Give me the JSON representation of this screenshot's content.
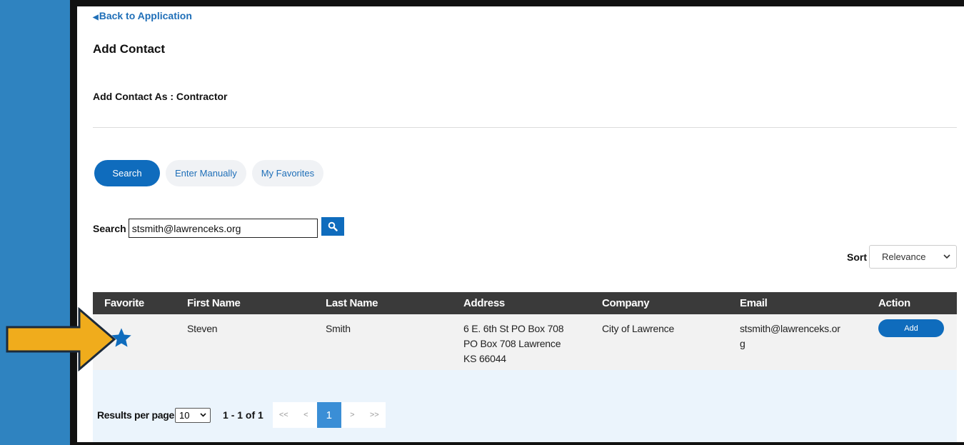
{
  "nav": {
    "back_label": "Back to Application"
  },
  "page": {
    "title": "Add Contact",
    "add_as": "Add Contact As  : Contractor"
  },
  "tabs": [
    {
      "label": "Search",
      "active": true
    },
    {
      "label": "Enter Manually",
      "active": false
    },
    {
      "label": "My Favorites",
      "active": false
    }
  ],
  "search": {
    "label": "Search",
    "value": "stsmith@lawrenceks.org",
    "button_icon": "search-icon"
  },
  "sort": {
    "label": "Sort",
    "selected": "Relevance"
  },
  "table": {
    "headers": [
      "Favorite",
      "First Name",
      "Last Name",
      "Address",
      "Company",
      "Email",
      "Action"
    ],
    "rows": [
      {
        "favorite_icon": "star-icon",
        "first_name": "Steven",
        "last_name": "Smith",
        "address_lines": [
          "6 E. 6th St PO Box 708",
          "PO Box 708 Lawrence",
          "KS 66044"
        ],
        "company": "City of Lawrence",
        "email_lines": [
          "stsmith@lawrenceks.or",
          "g"
        ],
        "action_label": "Add"
      }
    ]
  },
  "pagination": {
    "rpp_label": "Results per page",
    "rpp_value": "10",
    "range": "1 - 1 of 1",
    "first": "<<",
    "prev": "<",
    "current": "1",
    "next": ">",
    "last": ">>"
  },
  "colors": {
    "background": "#2f83c0",
    "primary": "#0f6cbd",
    "header": "#3a3a3a",
    "arrow": "#f0ac1c"
  }
}
